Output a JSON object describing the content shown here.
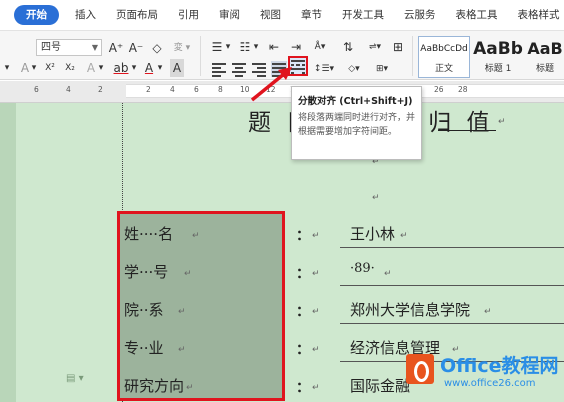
{
  "tabs": [
    "开始",
    "插入",
    "页面布局",
    "引用",
    "审阅",
    "视图",
    "章节",
    "开发工具",
    "云服务",
    "表格工具",
    "表格样式"
  ],
  "toolbar": {
    "font_size": "四号",
    "grow_font": "A⁺",
    "shrink_font": "A⁻",
    "clear_format": "◇",
    "superscript": "X²",
    "subscript": "X₂",
    "font_color": "A",
    "highlight": "ab",
    "char_shade": "A",
    "styles": [
      {
        "sample": "AaBbCcDd",
        "name": "正文"
      },
      {
        "sample": "AaBb",
        "name": "标题 1"
      },
      {
        "sample": "AaB",
        "name": "标题"
      }
    ]
  },
  "ruler_numbers": [
    "6",
    "4",
    "2",
    "2",
    "4",
    "6",
    "8",
    "10",
    "12",
    "14",
    "16",
    "18",
    "20",
    "22",
    "24",
    "26",
    "28"
  ],
  "tooltip": {
    "title": "分散对齐 (Ctrl+Shift+J)",
    "description": "将段落两端同时进行对齐，并根据需要增加字符间距。"
  },
  "document": {
    "title": "题 目 ⋯⋯ 上 归 值",
    "para_mark": "↵",
    "rows": [
      {
        "label": "姓····名",
        "colon": "：",
        "value": "王小林"
      },
      {
        "label": "学···号",
        "colon": "：",
        "value": "·89·"
      },
      {
        "label": "院··系",
        "colon": "：",
        "value": "郑州大学信息学院"
      },
      {
        "label": "专··业",
        "colon": "：",
        "value": "经济信息管理"
      },
      {
        "label": "研究方向",
        "colon": "：",
        "value": "国际金融"
      }
    ]
  },
  "watermark": {
    "name": "Office教程网",
    "url": "www.office26.com"
  },
  "colors": {
    "accent": "#2a6fd6",
    "doc_background": "#cfe8cf",
    "label_box": "#9cb39c",
    "highlight_red": "#e0141e"
  }
}
